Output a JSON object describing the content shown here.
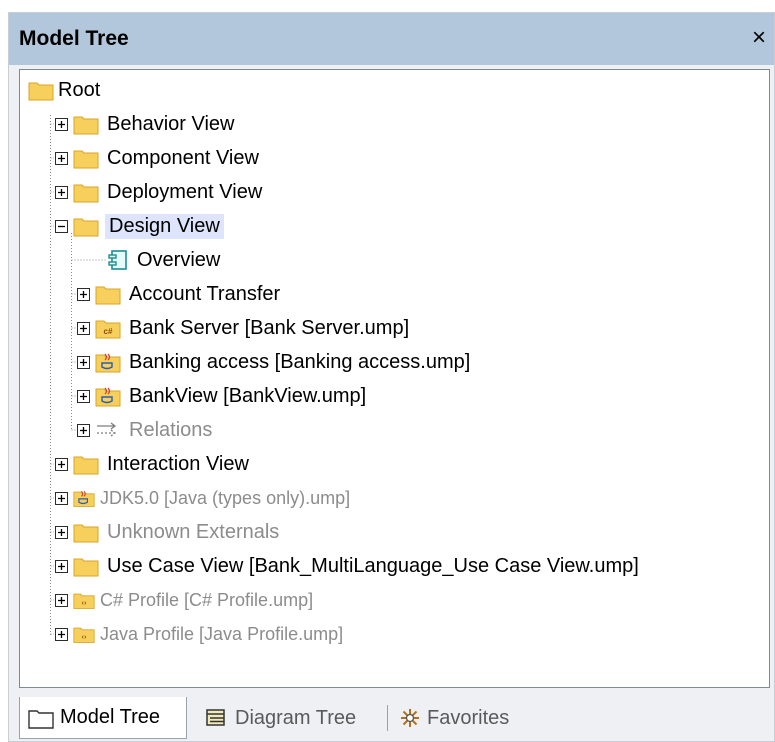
{
  "panel": {
    "title": "Model Tree",
    "close": "×"
  },
  "tree": {
    "root": "Root",
    "items": [
      {
        "label": "Behavior View",
        "state": "normal"
      },
      {
        "label": "Component View",
        "state": "normal"
      },
      {
        "label": "Deployment View",
        "state": "normal"
      },
      {
        "label": "Design View",
        "state": "selected",
        "children": [
          {
            "label": "Overview",
            "icon": "component-diagram-icon"
          },
          {
            "label": "Account Transfer",
            "icon": "folder-icon"
          },
          {
            "label": "Bank Server [Bank Server.ump]",
            "icon": "csharp-package-icon"
          },
          {
            "label": "Banking access [Banking access.ump]",
            "icon": "java-package-icon"
          },
          {
            "label": "BankView [BankView.ump]",
            "icon": "java-package-icon"
          },
          {
            "label": "Relations",
            "icon": "relations-icon",
            "dim": true
          }
        ]
      },
      {
        "label": "Interaction View",
        "state": "normal"
      },
      {
        "label": "JDK5.0 [Java (types only).ump]",
        "state": "dim"
      },
      {
        "label": "Unknown Externals",
        "state": "dim"
      },
      {
        "label": "Use Case View [Bank_MultiLanguage_Use Case View.ump]",
        "state": "normal"
      },
      {
        "label": "C# Profile [C# Profile.ump]",
        "state": "dim"
      },
      {
        "label": "Java Profile [Java Profile.ump]",
        "state": "dim"
      }
    ]
  },
  "tabs": [
    {
      "label": "Model Tree",
      "icon": "folder-icon",
      "active": true
    },
    {
      "label": "Diagram Tree",
      "icon": "diagram-tree-icon",
      "active": false
    },
    {
      "label": "Favorites",
      "icon": "favorites-icon",
      "active": false
    }
  ],
  "colors": {
    "titlebar": "#b2c7db",
    "selection": "#dde4fb",
    "folder": "#f7cf5d",
    "dim_text": "#8c8c8c"
  }
}
